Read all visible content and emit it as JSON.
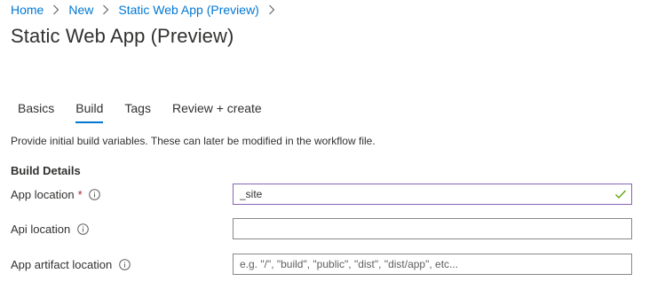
{
  "breadcrumb": {
    "items": [
      {
        "label": "Home"
      },
      {
        "label": "New"
      },
      {
        "label": "Static Web App (Preview)"
      }
    ]
  },
  "page": {
    "title": "Static Web App (Preview)"
  },
  "tabs": [
    {
      "label": "Basics",
      "active": false
    },
    {
      "label": "Build",
      "active": true
    },
    {
      "label": "Tags",
      "active": false
    },
    {
      "label": "Review + create",
      "active": false
    }
  ],
  "form": {
    "description": "Provide initial build variables. These can later be modified in the workflow file.",
    "section_heading": "Build Details",
    "fields": [
      {
        "label": "App location",
        "required": true,
        "required_marker": "*",
        "value": "_site",
        "placeholder": "",
        "valid": true
      },
      {
        "label": "Api location",
        "required": false,
        "value": "",
        "placeholder": ""
      },
      {
        "label": "App artifact location",
        "required": false,
        "value": "",
        "placeholder": "e.g. \"/\", \"build\", \"public\", \"dist\", \"dist/app\", etc..."
      }
    ]
  },
  "icons": {
    "breadcrumb_separator": "chevron-right-icon",
    "field_info": "info-icon",
    "field_valid": "checkmark-icon"
  },
  "colors": {
    "link": "#0078d4",
    "active_tab_underline": "#0078d4",
    "required": "#a4262c",
    "valid_border": "#8764b8",
    "valid_check": "#57a300",
    "input_border": "#8a8886"
  }
}
